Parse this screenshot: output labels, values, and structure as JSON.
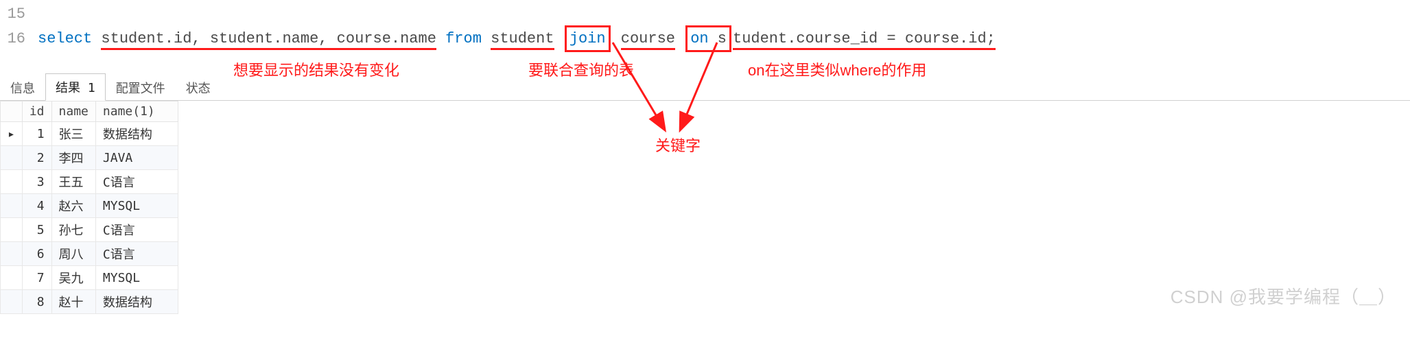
{
  "code": {
    "line15_num": "15",
    "line16_num": "16",
    "select": "select",
    "cols": "student.id, student.name, course.name",
    "from": "from",
    "table1": "student",
    "join": "join",
    "table2": "course",
    "on": "on",
    "s_pfx": "s",
    "cond": "tudent.course_id = course.id;"
  },
  "tabs": {
    "info": "信息",
    "result1": "结果 1",
    "profile": "配置文件",
    "status": "状态"
  },
  "table": {
    "headers": {
      "id": "id",
      "name": "name",
      "name1": "name(1)"
    },
    "rows": [
      {
        "marker": "▸",
        "id": "1",
        "name": "张三",
        "name1": "数据结构"
      },
      {
        "marker": "",
        "id": "2",
        "name": "李四",
        "name1": "JAVA"
      },
      {
        "marker": "",
        "id": "3",
        "name": "王五",
        "name1": "C语言"
      },
      {
        "marker": "",
        "id": "4",
        "name": "赵六",
        "name1": "MYSQL"
      },
      {
        "marker": "",
        "id": "5",
        "name": "孙七",
        "name1": "C语言"
      },
      {
        "marker": "",
        "id": "6",
        "name": "周八",
        "name1": "C语言"
      },
      {
        "marker": "",
        "id": "7",
        "name": "吴九",
        "name1": "MYSQL"
      },
      {
        "marker": "",
        "id": "8",
        "name": "赵十",
        "name1": "数据结构"
      }
    ]
  },
  "annotations": {
    "a1": "想要显示的结果没有变化",
    "a2": "要联合查询的表",
    "a3": "on在这里类似where的作用",
    "a4": "关键字"
  },
  "watermark": "CSDN @我要学编程（＿）"
}
